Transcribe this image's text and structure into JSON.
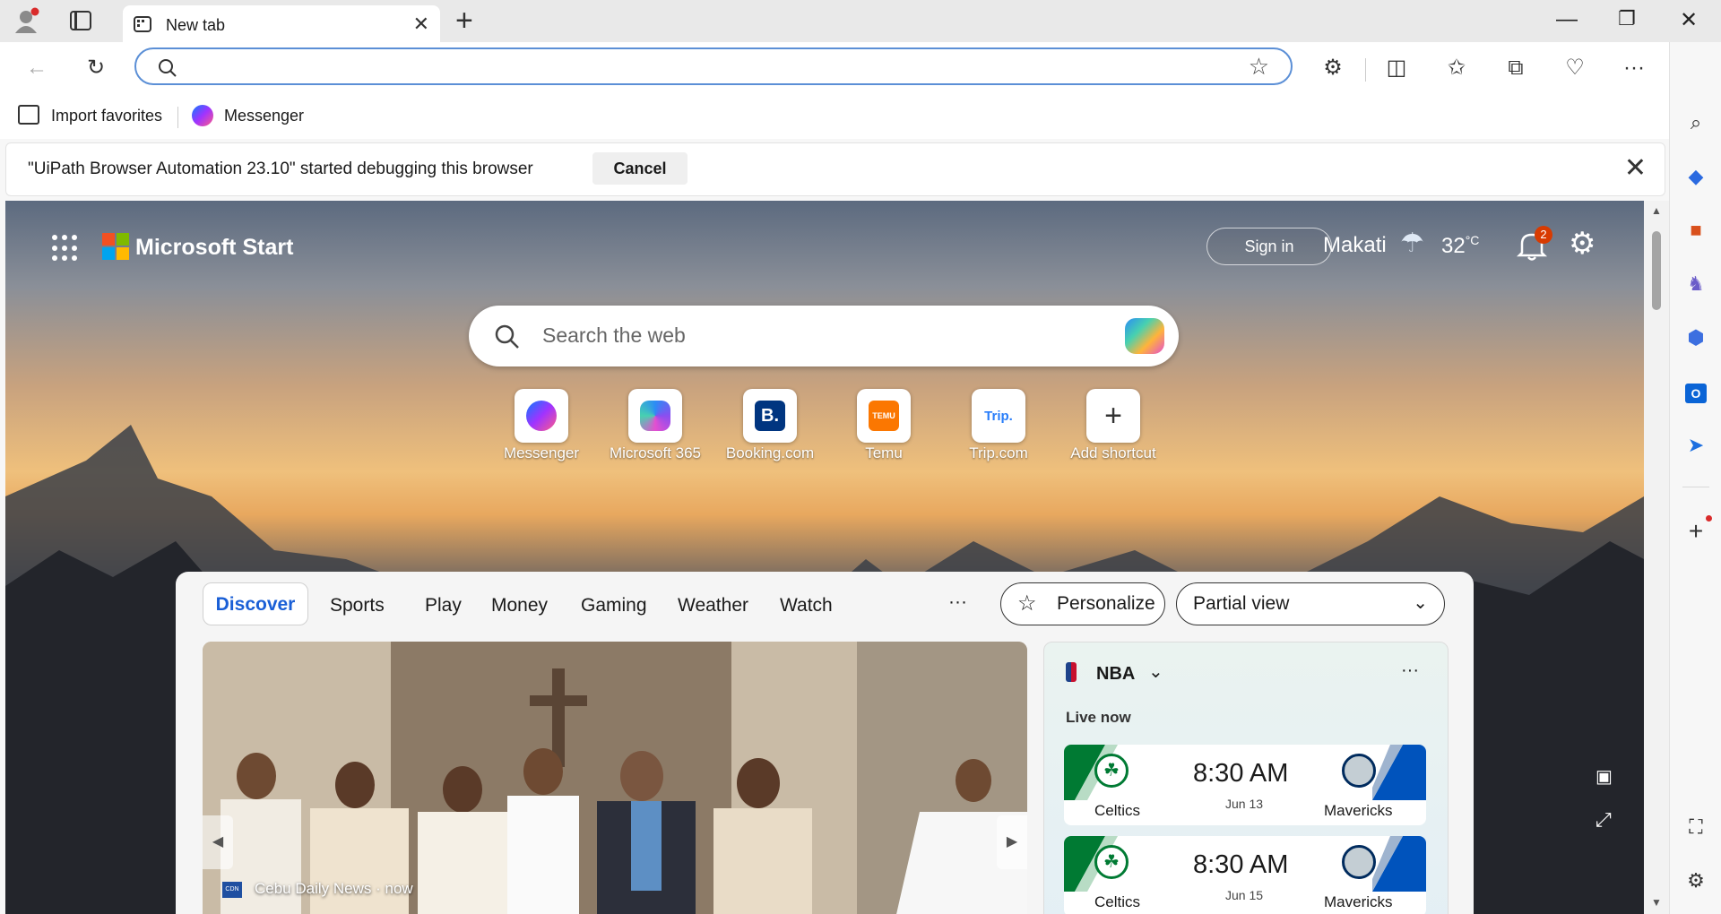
{
  "browser": {
    "tab_title": "New tab",
    "favorites": [
      "Import favorites",
      "Messenger"
    ],
    "infobar": {
      "message": "\"UiPath Browser Automation 23.10\" started debugging this browser",
      "cancel_label": "Cancel"
    }
  },
  "header": {
    "brand": "Microsoft Start",
    "sign_in": "Sign in",
    "location": "Makati",
    "temperature": "32",
    "temp_unit": "°C",
    "notification_count": "2"
  },
  "search": {
    "placeholder": "Search the web"
  },
  "shortcuts": [
    {
      "label": "Messenger"
    },
    {
      "label": "Microsoft 365"
    },
    {
      "label": "Booking.com"
    },
    {
      "label": "Temu"
    },
    {
      "label": "Trip.com"
    },
    {
      "label": "Add shortcut"
    }
  ],
  "feed": {
    "tabs": [
      "Discover",
      "Sports",
      "Play",
      "Money",
      "Gaming",
      "Weather",
      "Watch"
    ],
    "personalize": "Personalize",
    "view_mode": "Partial view",
    "news": {
      "source_badge": "CDN",
      "source": "Cebu Daily News · now"
    },
    "nba": {
      "title": "NBA",
      "live_label": "Live now",
      "games": [
        {
          "home": "Celtics",
          "time": "8:30 AM",
          "date": "Jun 13",
          "away": "Mavericks"
        },
        {
          "home": "Celtics",
          "time": "8:30 AM",
          "date": "Jun 15",
          "away": "Mavericks"
        }
      ]
    }
  },
  "colors": {
    "accent": "#1a5fd6",
    "badge": "#d83b01",
    "celtics": "#007a33",
    "mavericks": "#0053bc"
  }
}
